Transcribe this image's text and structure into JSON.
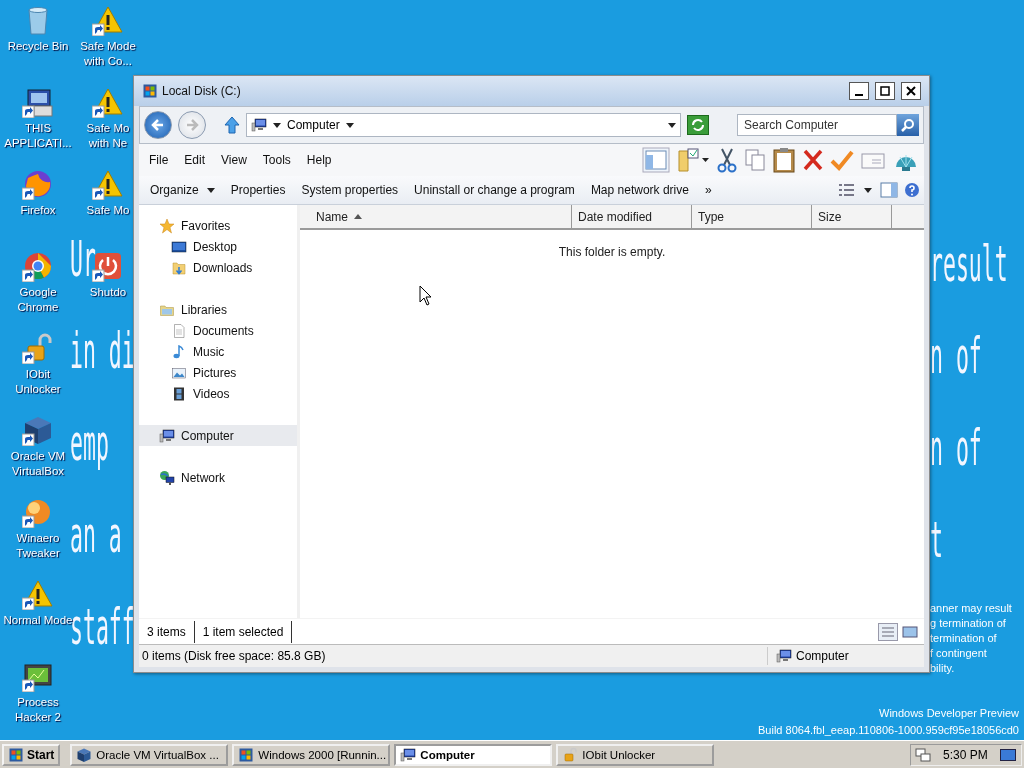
{
  "desktop": {
    "icons": [
      {
        "label": "Recycle Bin",
        "kind": "recycle"
      },
      {
        "label": "THIS APPLICATI...",
        "kind": "app"
      },
      {
        "label": "Firefox",
        "kind": "firefox"
      },
      {
        "label": "Google Chrome",
        "kind": "chrome"
      },
      {
        "label": "IObit Unlocker",
        "kind": "unlock"
      },
      {
        "label": "Oracle VM VirtualBox",
        "kind": "virtualbox"
      },
      {
        "label": "Winaero Tweaker",
        "kind": "winaero"
      },
      {
        "label": "Normal Mode",
        "kind": "warning"
      },
      {
        "label": "Process Hacker 2",
        "kind": "hacker"
      },
      {
        "label": "Safe Mode with Co...",
        "kind": "warning"
      },
      {
        "label": "Safe Mo with Ne",
        "kind": "warning"
      },
      {
        "label": "Safe Mo",
        "kind": "warning"
      },
      {
        "label": "Shutdo",
        "kind": "power"
      }
    ],
    "wallpaper_left": [
      "Ur",
      "in di",
      "emp",
      "an a",
      "staff"
    ],
    "wallpaper_right": [
      "result",
      "n of",
      "n of",
      "t"
    ],
    "notice": [
      "anner may result",
      "g termination of",
      "termination of",
      "f contingent",
      "bility."
    ],
    "build": [
      "Windows Developer Preview",
      "Build 8064.fbl_eeap.110806-1000.959cf95e18056cd0"
    ]
  },
  "window": {
    "title": "Local Disk (C:)",
    "address": "Computer",
    "search_placeholder": "Search Computer",
    "menu": [
      "File",
      "Edit",
      "View",
      "Tools",
      "Help"
    ],
    "commands": [
      {
        "label": "Organize",
        "dropdown": true
      },
      {
        "label": "Properties",
        "dropdown": false
      },
      {
        "label": "System properties",
        "dropdown": false
      },
      {
        "label": "Uninstall or change a program",
        "dropdown": false
      },
      {
        "label": "Map network drive",
        "dropdown": false
      }
    ],
    "more": "»",
    "nav": [
      {
        "label": "Favorites",
        "kind": "star",
        "selected": false,
        "children": [
          {
            "label": "Desktop",
            "kind": "desktop",
            "selected": false
          },
          {
            "label": "Downloads",
            "kind": "downloads",
            "selected": false
          }
        ]
      },
      {
        "label": "Libraries",
        "kind": "library",
        "selected": false,
        "children": [
          {
            "label": "Documents",
            "kind": "document",
            "selected": false
          },
          {
            "label": "Music",
            "kind": "music",
            "selected": false
          },
          {
            "label": "Pictures",
            "kind": "picture",
            "selected": false
          },
          {
            "label": "Videos",
            "kind": "video",
            "selected": false
          }
        ]
      },
      {
        "label": "Computer",
        "kind": "computer",
        "selected": true
      },
      {
        "label": "Network",
        "kind": "network",
        "selected": false
      }
    ],
    "columns": [
      {
        "label": "Name",
        "sorted": true
      },
      {
        "label": "Date modified",
        "sorted": false
      },
      {
        "label": "Type",
        "sorted": false
      },
      {
        "label": "Size",
        "sorted": false
      }
    ],
    "empty_message": "This folder is empty.",
    "details": [
      "3 items",
      "1 item selected"
    ],
    "status": {
      "text": "0 items (Disk free space: 85.8 GB)",
      "location": "Computer"
    }
  },
  "taskbar": {
    "start": "Start",
    "tasks": [
      {
        "label": "Oracle VM VirtualBox ...",
        "kind": "virtualbox",
        "selected": false
      },
      {
        "label": "Windows 2000 [Runnin...",
        "kind": "win2000",
        "selected": false
      },
      {
        "label": "Computer",
        "kind": "computer",
        "selected": true
      },
      {
        "label": "IObit Unlocker",
        "kind": "unlock",
        "selected": false
      }
    ],
    "clock": "5:30 PM"
  }
}
